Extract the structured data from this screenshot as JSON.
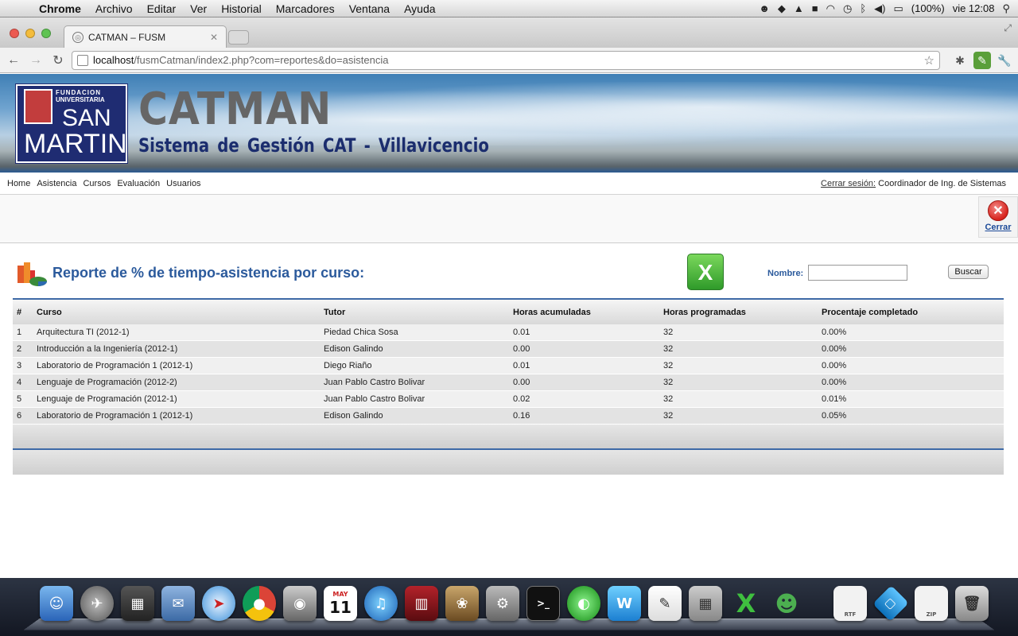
{
  "menubar": {
    "app": "Chrome",
    "items": [
      "Archivo",
      "Editar",
      "Ver",
      "Historial",
      "Marcadores",
      "Ventana",
      "Ayuda"
    ],
    "battery": "(100%)",
    "clock": "vie 12:08"
  },
  "browser": {
    "tab_title": "CATMAN – FUSM",
    "url_host": "localhost",
    "url_path": "/fusmCatman/index2.php?com=reportes&do=asistencia"
  },
  "banner": {
    "logo_line1": "FUNDACION",
    "logo_line2": "UNIVERSITARIA",
    "logo_line3": "SAN",
    "logo_line4": "MARTIN",
    "title": "CATMAN",
    "subtitle": "Sistema de Gestión CAT - Villavicencio"
  },
  "nav": {
    "links": [
      "Home",
      "Asistencia",
      "Cursos",
      "Evaluación",
      "Usuarios"
    ],
    "logout_label": "Cerrar sesión:",
    "user": "Coordinador de Ing. de Sistemas"
  },
  "actions": {
    "close_label": "Cerrar"
  },
  "report": {
    "title": "Reporte de % de tiempo-asistencia por curso:",
    "search_label": "Nombre:",
    "search_value": "",
    "search_button": "Buscar",
    "columns": [
      "#",
      "Curso",
      "Tutor",
      "Horas acumuladas",
      "Horas programadas",
      "Procentaje completado"
    ],
    "rows": [
      [
        "1",
        "Arquitectura TI (2012-1)",
        "Piedad Chica Sosa",
        "0.01",
        "32",
        "0.00%"
      ],
      [
        "2",
        "Introducción a la Ingeniería (2012-1)",
        "Edison Galindo",
        "0.00",
        "32",
        "0.00%"
      ],
      [
        "3",
        "Laboratorio de Programación 1 (2012-1)",
        "Diego Riaño",
        "0.01",
        "32",
        "0.00%"
      ],
      [
        "4",
        "Lenguaje de Programación (2012-2)",
        "Juan Pablo Castro Bolivar",
        "0.00",
        "32",
        "0.00%"
      ],
      [
        "5",
        "Lenguaje de Programación (2012-1)",
        "Juan Pablo Castro Bolivar",
        "0.02",
        "32",
        "0.01%"
      ],
      [
        "6",
        "Laboratorio de Programación 1 (2012-1)",
        "Edison Galindo",
        "0.16",
        "32",
        "0.05%"
      ]
    ]
  },
  "dock": {
    "calendar_month": "MAY",
    "calendar_day": "11",
    "file_labels": [
      "RTF",
      "ZIP"
    ]
  }
}
